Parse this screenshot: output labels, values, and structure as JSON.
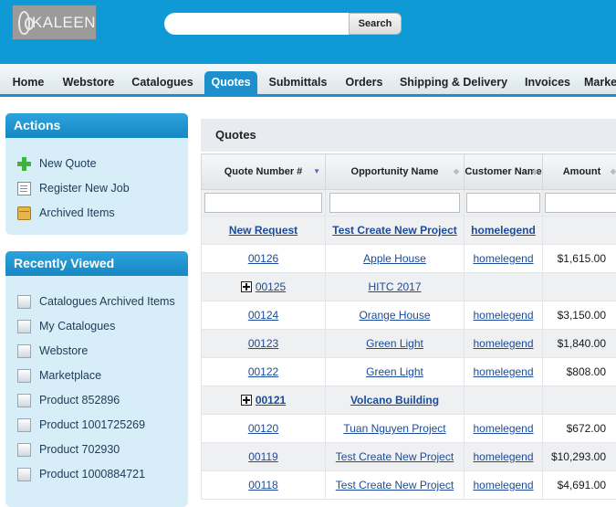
{
  "header": {
    "logo_text": "KALEEN",
    "search_placeholder": "",
    "search_button": "Search"
  },
  "nav": {
    "tabs": [
      "Home",
      "Webstore",
      "Catalogues",
      "Quotes",
      "Submittals",
      "Orders",
      "Shipping & Delivery",
      "Invoices",
      "Marke"
    ],
    "active": "Quotes"
  },
  "actions": {
    "title": "Actions",
    "items": [
      {
        "label": "New Quote",
        "icon": "plus-icon"
      },
      {
        "label": "Register New Job",
        "icon": "register-icon"
      },
      {
        "label": "Archived Items",
        "icon": "archive-box-icon"
      }
    ]
  },
  "recent": {
    "title": "Recently Viewed",
    "items": [
      "Catalogues Archived Items",
      "My Catalogues",
      "Webstore",
      "Marketplace",
      "Product 852896",
      "Product 1001725269",
      "Product 702930",
      "Product 1000884721"
    ]
  },
  "main": {
    "title": "Quotes",
    "columns": [
      "Quote Number #",
      "Opportunity Name",
      "Customer Name",
      "Amount"
    ],
    "rows": [
      {
        "quote": "New Request",
        "opportunity": "Test Create New Project",
        "customer": "homelegend",
        "amount": "",
        "bold": true,
        "expander": false
      },
      {
        "quote": "00126",
        "opportunity": "Apple House",
        "customer": "homelegend",
        "amount": "$1,615.00",
        "bold": false,
        "expander": false
      },
      {
        "quote": "00125",
        "opportunity": "HITC 2017",
        "customer": "",
        "amount": "",
        "bold": false,
        "expander": true
      },
      {
        "quote": "00124",
        "opportunity": "Orange House",
        "customer": "homelegend",
        "amount": "$3,150.00",
        "bold": false,
        "expander": false
      },
      {
        "quote": "00123",
        "opportunity": "Green Light",
        "customer": "homelegend",
        "amount": "$1,840.00",
        "bold": false,
        "expander": false
      },
      {
        "quote": "00122",
        "opportunity": "Green Light",
        "customer": "homelegend",
        "amount": "$808.00",
        "bold": false,
        "expander": false
      },
      {
        "quote": "00121",
        "opportunity": "Volcano Building",
        "customer": "",
        "amount": "",
        "bold": true,
        "expander": true
      },
      {
        "quote": "00120",
        "opportunity": "Tuan Nguyen Project",
        "customer": "homelegend",
        "amount": "$672.00",
        "bold": false,
        "expander": false
      },
      {
        "quote": "00119",
        "opportunity": "Test Create New Project",
        "customer": "homelegend",
        "amount": "$10,293.00",
        "bold": false,
        "expander": false
      },
      {
        "quote": "00118",
        "opportunity": "Test Create New Project",
        "customer": "homelegend",
        "amount": "$4,691.00",
        "bold": false,
        "expander": false
      }
    ]
  },
  "colors": {
    "brand_blue": "#0f9ad6",
    "tab_active": "#1c8fcc",
    "panel_bg": "#d7eef8",
    "link": "#1b4b9b"
  }
}
